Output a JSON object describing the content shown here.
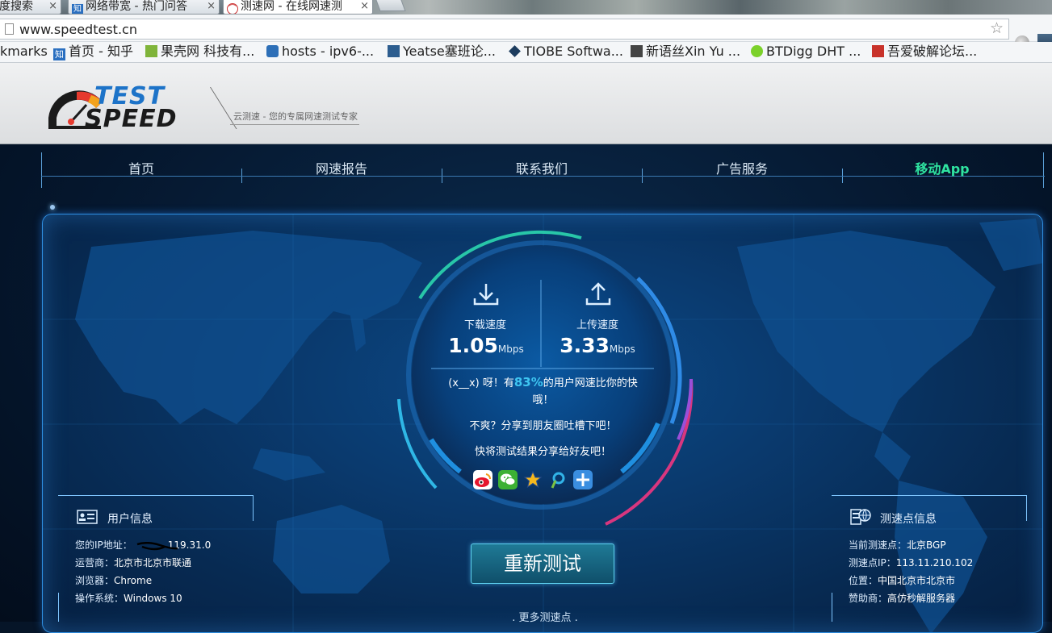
{
  "browser": {
    "tabs": [
      {
        "label": "度搜索",
        "icon": "",
        "active": false
      },
      {
        "label": "网络带宽 - 热门问答",
        "icon": "知",
        "active": false
      },
      {
        "label": "测速网 - 在线网速测",
        "icon": "",
        "active": true
      }
    ],
    "url": "www.speedtest.cn",
    "bookmarks_edge": "kmarks",
    "bookmarks": [
      {
        "label": "首页 - 知乎",
        "color": "#2a6fc0"
      },
      {
        "label": "果壳网 科技有...",
        "color": "#7fb43a"
      },
      {
        "label": "hosts - ipv6-...",
        "color": "#2d6fb7"
      },
      {
        "label": "Yeatse塞班论...",
        "color": "#2c5d8f"
      },
      {
        "label": "TIOBE Softwa...",
        "color": "#1c3c5e"
      },
      {
        "label": "新语丝Xin Yu ...",
        "color": "#444444"
      },
      {
        "label": "BTDigg DHT ...",
        "color": "#7bd12a"
      },
      {
        "label": "吾爱破解论坛...",
        "color": "#c8322a"
      }
    ]
  },
  "site": {
    "logo_top": "TEST",
    "logo_bottom": "SPEED",
    "slogan": "云测速 - 您的专属网速测试专家",
    "nav": [
      "首页",
      "网速报告",
      "联系我们",
      "广告服务",
      "移动App"
    ]
  },
  "speed": {
    "download_label": "下载速度",
    "download_value": "1.05",
    "download_unit": "Mbps",
    "upload_label": "上传速度",
    "upload_value": "3.33",
    "upload_unit": "Mbps",
    "msg_prefix": "(x__x) 呀！有",
    "msg_pct": "83%",
    "msg_suffix": "的用户网速比你的快",
    "msg_line2": "哦！",
    "msg_line3": "不爽？分享到朋友圈吐槽下吧！",
    "msg_line4": "快将测试结果分享给好友吧！",
    "share_icons": [
      "weibo-icon",
      "wechat-icon",
      "qzone-icon",
      "tencent-weibo-icon",
      "more-share-icon"
    ],
    "retest_label": "重新测试",
    "more_label": ". 更多测速点 ."
  },
  "user_info": {
    "title": "用户信息",
    "ip_label": "您的IP地址：",
    "ip_value": "119.31.0",
    "isp_label": "运营商：",
    "isp_value": "北京市北京市联通",
    "browser_label": "浏览器：",
    "browser_value": "Chrome",
    "os_label": "操作系统：",
    "os_value": "Windows 10"
  },
  "node_info": {
    "title": "测速点信息",
    "node_label": "当前测速点：",
    "node_value": "北京BGP",
    "ip_label": "测速点IP：",
    "ip_value": "113.11.210.102",
    "loc_label": "位置：",
    "loc_value": "中国北京市北京市",
    "sponsor_label": "赞助商：",
    "sponsor_value": "高仿秒解服务器"
  }
}
